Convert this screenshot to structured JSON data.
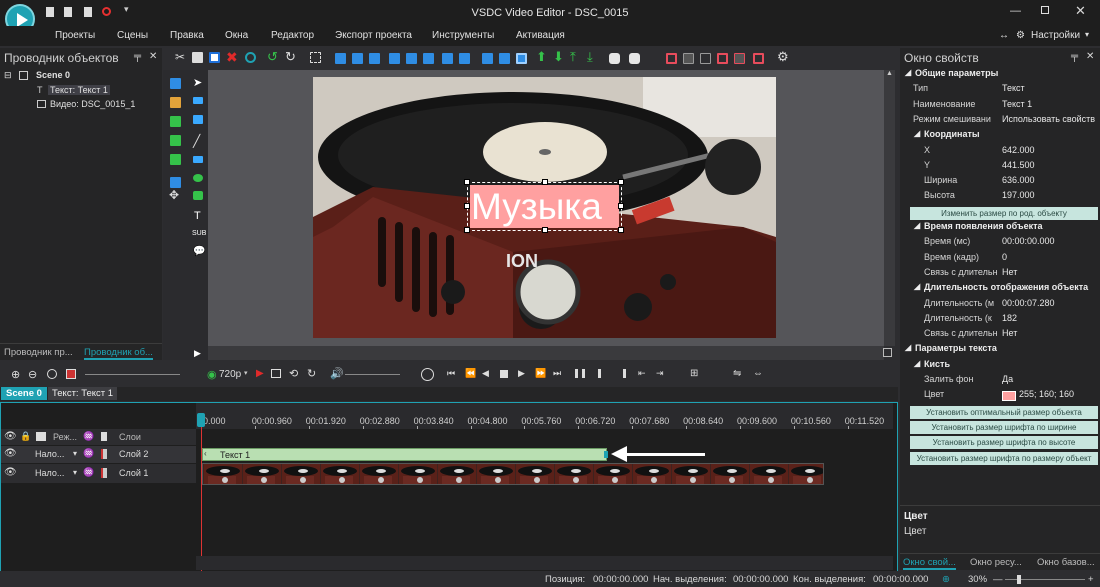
{
  "app": {
    "title": "VSDC Video Editor - DSC_0015"
  },
  "menu": {
    "items": [
      "Проекты",
      "Сцены",
      "Правка",
      "Окна",
      "Редактор",
      "Экспорт проекта",
      "Инструменты",
      "Активация"
    ],
    "settings": "Настройки"
  },
  "explorer": {
    "title": "Проводник объектов",
    "tree": [
      "Scene 0",
      "Текст: Текст 1",
      "Видео: DSC_0015_1"
    ],
    "tabs": [
      "Проводник пр...",
      "Проводник об..."
    ]
  },
  "canvas": {
    "overlay_text": "Музыка"
  },
  "playback": {
    "resolution": "720p"
  },
  "timeline": {
    "tabs": [
      "Scene 0",
      "Текст: Текст 1"
    ],
    "ruler": [
      "0.000",
      "00:00.960",
      "00:01.920",
      "00:02.880",
      "00:03.840",
      "00:04.800",
      "00:05.760",
      "00:06.720",
      "00:07.680",
      "00:08.640",
      "00:09.600",
      "00:10.560",
      "00:11.520"
    ],
    "header": {
      "mode": "Реж...",
      "layers": "Слои"
    },
    "rows": [
      {
        "blend": "Нало...",
        "layer": "Слой 2",
        "clip": "Текст 1"
      },
      {
        "blend": "Нало...",
        "layer": "Слой 1"
      }
    ]
  },
  "properties": {
    "title": "Окно свойств",
    "general_section": "Общие параметры",
    "general": [
      {
        "k": "Тип",
        "v": "Текст"
      },
      {
        "k": "Наименование",
        "v": "Текст 1"
      },
      {
        "k": "Режим смешивани",
        "v": "Использовать свойств"
      }
    ],
    "coords_section": "Координаты",
    "coords": [
      {
        "k": "X",
        "v": "642.000"
      },
      {
        "k": "Y",
        "v": "441.500"
      },
      {
        "k": "Ширина",
        "v": "636.000"
      },
      {
        "k": "Высота",
        "v": "197.000"
      }
    ],
    "resize_button": "Изменить размер по род. объекту",
    "appear_section": "Время появления объекта",
    "appear": [
      {
        "k": "Время (мс)",
        "v": "00:00:00.000"
      },
      {
        "k": "Время (кадр)",
        "v": "0"
      },
      {
        "k": "Связь с длительн",
        "v": "Нет"
      }
    ],
    "duration_section": "Длительность отображения объекта",
    "duration": [
      {
        "k": "Длительность (м",
        "v": "00:00:07.280"
      },
      {
        "k": "Длительность (к",
        "v": "182"
      },
      {
        "k": "Связь с длительн",
        "v": "Нет"
      }
    ],
    "text_section": "Параметры текста",
    "brush_section": "Кисть",
    "fill": {
      "k": "Залить фон",
      "v": "Да"
    },
    "color": {
      "k": "Цвет",
      "v": "255; 160; 160",
      "swatch": "#ffa0a0"
    },
    "buttons": [
      "Установить оптимальный размер объекта",
      "Установить размер шрифта по ширине",
      "Установить размер шрифта по высоте",
      "Установить размер шрифта по размеру объект"
    ],
    "desc_title": "Цвет",
    "desc_text": "Цвет",
    "tabs": [
      "Окно свой...",
      "Окно ресу...",
      "Окно базов..."
    ]
  },
  "status": {
    "position_label": "Позиция:",
    "position": "00:00:00.000",
    "sel_start_label": "Нач. выделения:",
    "sel_start": "00:00:00.000",
    "sel_end_label": "Кон. выделения:",
    "sel_end": "00:00:00.000",
    "zoom": "30%"
  },
  "colors": {
    "accent": "#1fa2b3",
    "clip": "#b9dfb2",
    "text_bg": "#ffa0a0"
  }
}
